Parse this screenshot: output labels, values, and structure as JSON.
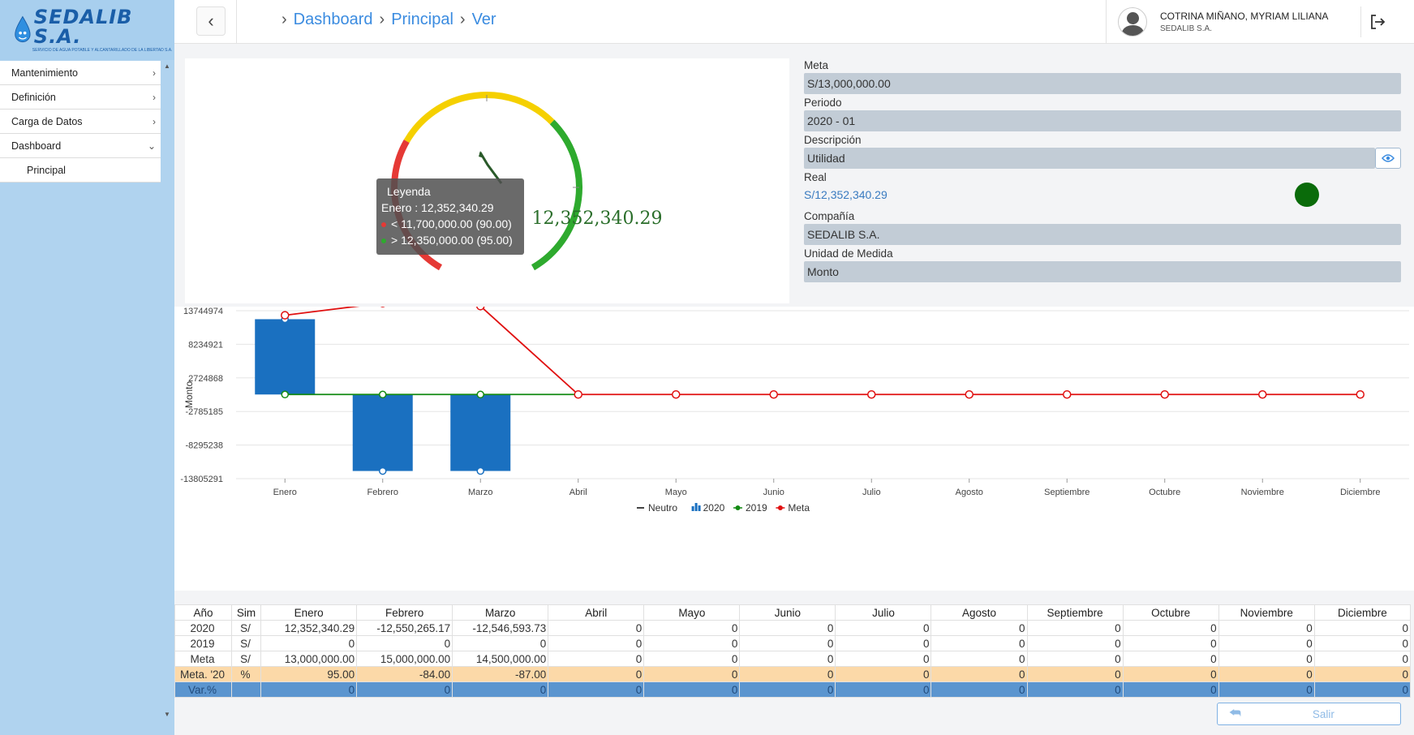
{
  "logo": {
    "brand": "SEDALIB S.A.",
    "tagline": "SERVICIO DE AGUA POTABLE Y ALCANTARILLADO DE LA LIBERTAD S.A."
  },
  "sidebar": {
    "items": [
      {
        "label": "Mantenimiento",
        "chevron": ">"
      },
      {
        "label": "Definición",
        "chevron": ">"
      },
      {
        "label": "Carga de Datos",
        "chevron": ">"
      },
      {
        "label": "Dashboard",
        "chevron": "v"
      }
    ],
    "subitems": [
      {
        "label": "Principal"
      }
    ]
  },
  "header": {
    "back_icon": "chevron-left-icon",
    "breadcrumbs": [
      "Dashboard",
      "Principal",
      "Ver"
    ],
    "user_name": "COTRINA MIÑANO, MYRIAM LILIANA",
    "user_company": "SEDALIB S.A.",
    "logout_icon": "logout-icon"
  },
  "gauge": {
    "value_text": "12,352,340.29",
    "tooltip": {
      "title": "Leyenda",
      "line1": "Enero : 12,352,340.29",
      "line2": "<  11,700,000.00 (90.00)",
      "line3": ">  12,350,000.00 (95.00)"
    },
    "colors": {
      "red": "#e53935",
      "yellow": "#f5d000",
      "green": "#2eaa2e"
    }
  },
  "fields": {
    "meta_label": "Meta",
    "meta_value": "S/13,000,000.00",
    "periodo_label": "Periodo",
    "periodo_value": "2020 - 01",
    "descripcion_label": "Descripción",
    "descripcion_value": "Utilidad",
    "real_label": "Real",
    "real_value": "S/12,352,340.29",
    "compania_label": "Compañía",
    "compania_value": "SEDALIB S.A.",
    "unidad_label": "Unidad de Medida",
    "unidad_value": "Monto",
    "status_color": "#0a6b0a"
  },
  "chart_data": {
    "type": "bar",
    "categories": [
      "Enero",
      "Febrero",
      "Marzo",
      "Abril",
      "Mayo",
      "Junio",
      "Julio",
      "Agosto",
      "Septiembre",
      "Octubre",
      "Noviembre",
      "Diciembre"
    ],
    "ylabel": "Monto",
    "ylim": [
      -13805291,
      13744974
    ],
    "yticks": [
      13744974,
      8234921,
      2724868,
      -2785185,
      -8295238,
      -13805291
    ],
    "series": [
      {
        "name": "Neutro",
        "type": "line",
        "values": []
      },
      {
        "name": "2020",
        "type": "bar",
        "color": "#1a70c0",
        "values": [
          12352340.29,
          -12550265.17,
          -12546593.73,
          0,
          0,
          0,
          0,
          0,
          0,
          0,
          0,
          0
        ]
      },
      {
        "name": "2019",
        "type": "line",
        "color": "#138a13",
        "values": [
          0,
          0,
          0,
          0,
          0,
          0,
          0,
          0,
          0,
          0,
          0,
          0
        ]
      },
      {
        "name": "Meta",
        "type": "line",
        "color": "#e01010",
        "values": [
          13000000,
          15000000,
          14500000,
          0,
          0,
          0,
          0,
          0,
          0,
          0,
          0,
          0
        ]
      }
    ],
    "legend": "bottom",
    "grid": true
  },
  "table": {
    "headers": [
      "Año",
      "Sim",
      "Enero",
      "Febrero",
      "Marzo",
      "Abril",
      "Mayo",
      "Junio",
      "Julio",
      "Agosto",
      "Septiembre",
      "Octubre",
      "Noviembre",
      "Diciembre"
    ],
    "rows": [
      {
        "cls": "",
        "cells": [
          "2020",
          "S/",
          "12,352,340.29",
          "-12,550,265.17",
          "-12,546,593.73",
          "0",
          "0",
          "0",
          "0",
          "0",
          "0",
          "0",
          "0",
          "0"
        ]
      },
      {
        "cls": "",
        "cells": [
          "2019",
          "S/",
          "0",
          "0",
          "0",
          "0",
          "0",
          "0",
          "0",
          "0",
          "0",
          "0",
          "0",
          "0"
        ]
      },
      {
        "cls": "",
        "cells": [
          "Meta",
          "S/",
          "13,000,000.00",
          "15,000,000.00",
          "14,500,000.00",
          "0",
          "0",
          "0",
          "0",
          "0",
          "0",
          "0",
          "0",
          "0"
        ]
      },
      {
        "cls": "meta20",
        "cells": [
          "Meta. '20",
          "%",
          "95.00",
          "-84.00",
          "-87.00",
          "0",
          "0",
          "0",
          "0",
          "0",
          "0",
          "0",
          "0",
          "0"
        ]
      },
      {
        "cls": "var",
        "cells": [
          "Var.%",
          "",
          "0",
          "0",
          "0",
          "0",
          "0",
          "0",
          "0",
          "0",
          "0",
          "0",
          "0",
          "0"
        ]
      }
    ]
  },
  "footer": {
    "salir_label": "Salir",
    "salir_icon": "reply-icon"
  }
}
